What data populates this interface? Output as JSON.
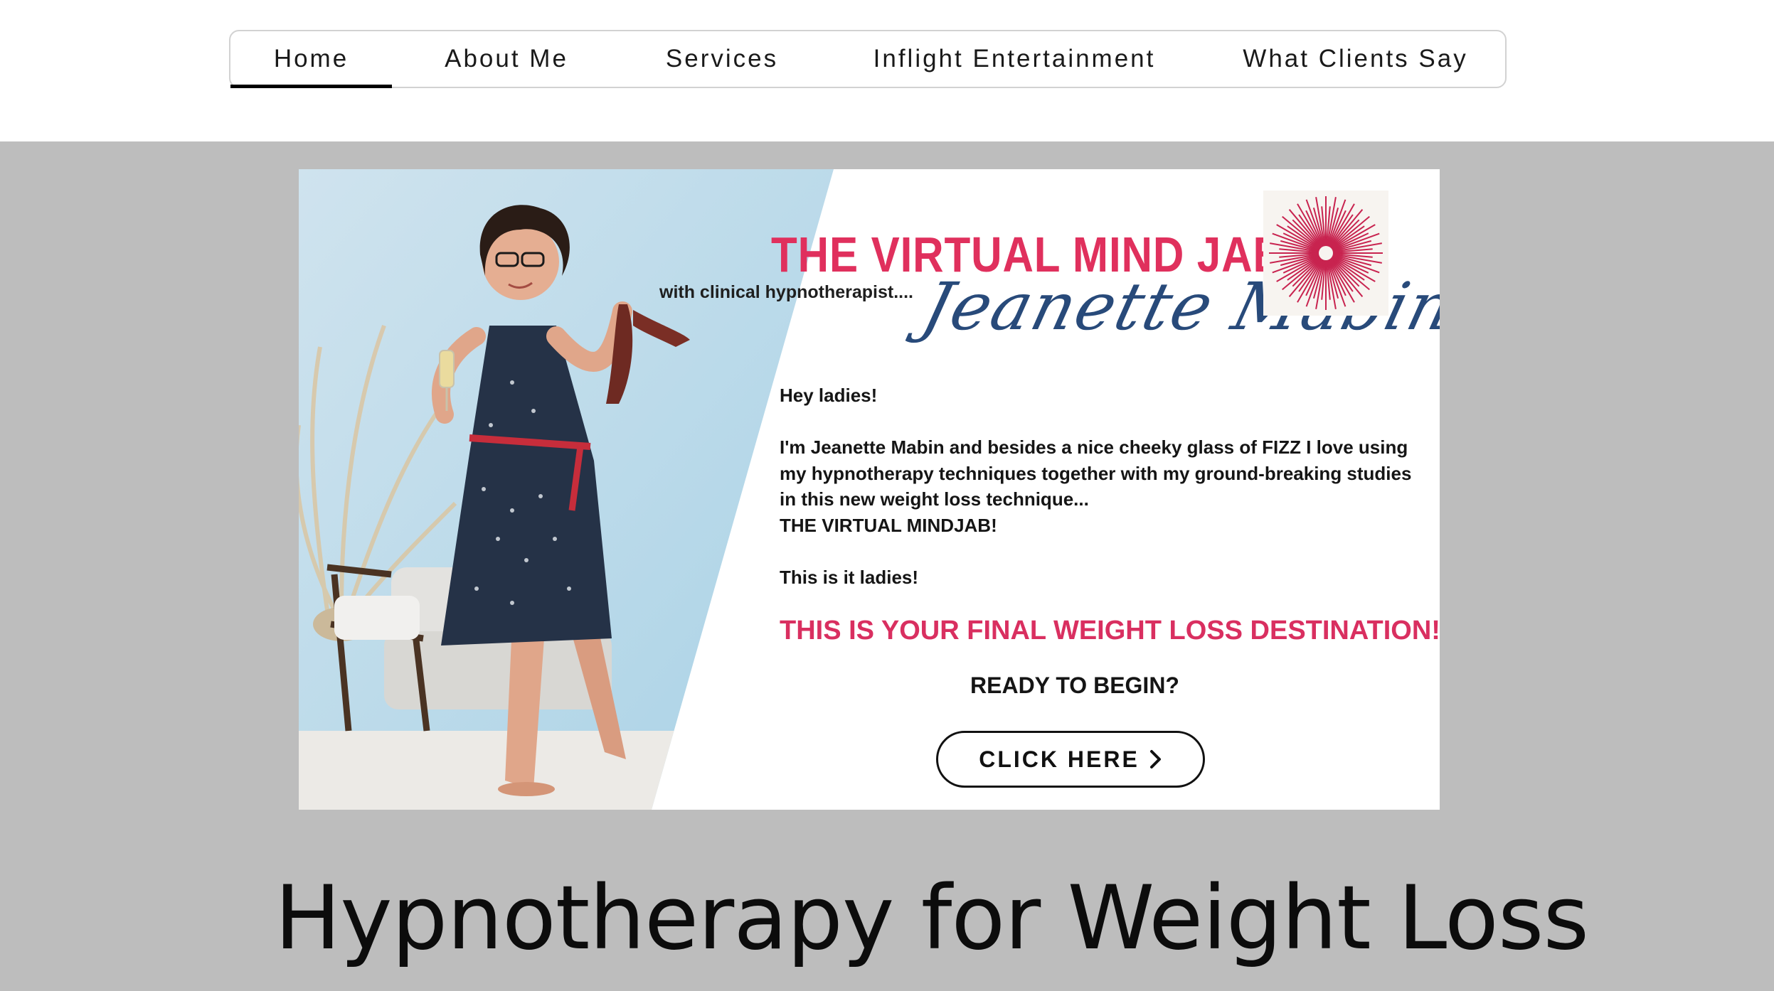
{
  "nav": {
    "items": [
      {
        "label": "Home",
        "active": true
      },
      {
        "label": "About Me",
        "active": false
      },
      {
        "label": "Services",
        "active": false
      },
      {
        "label": "Inflight Entertainment",
        "active": false
      },
      {
        "label": "What Clients Say",
        "active": false
      }
    ]
  },
  "hero": {
    "title": "THE VIRTUAL MIND JAB",
    "subtitle": "with clinical hypnotherapist....",
    "signature": "Jeanette Mabin",
    "body": [
      "Hey ladies!",
      "",
      "I'm Jeanette Mabin and besides a nice cheeky glass of FIZZ I love using",
      "my hypnotherapy techniques together with my ground-breaking studies",
      "in this new weight loss technique...",
      "THE VIRTUAL MINDJAB!",
      "",
      "This is it ladies!"
    ],
    "headline": "THIS IS YOUR FINAL WEIGHT LOSS DESTINATION!",
    "ready": "READY TO BEGIN?",
    "cta_label": "CLICK HERE",
    "cta_icon": "chevron-right-icon",
    "colors": {
      "accent": "#e0305d",
      "signature": "#284a7a",
      "burst": "#c8234f"
    }
  },
  "page": {
    "heading": "Hypnotherapy for Weight Loss",
    "band_color": "#bdbdbd"
  }
}
